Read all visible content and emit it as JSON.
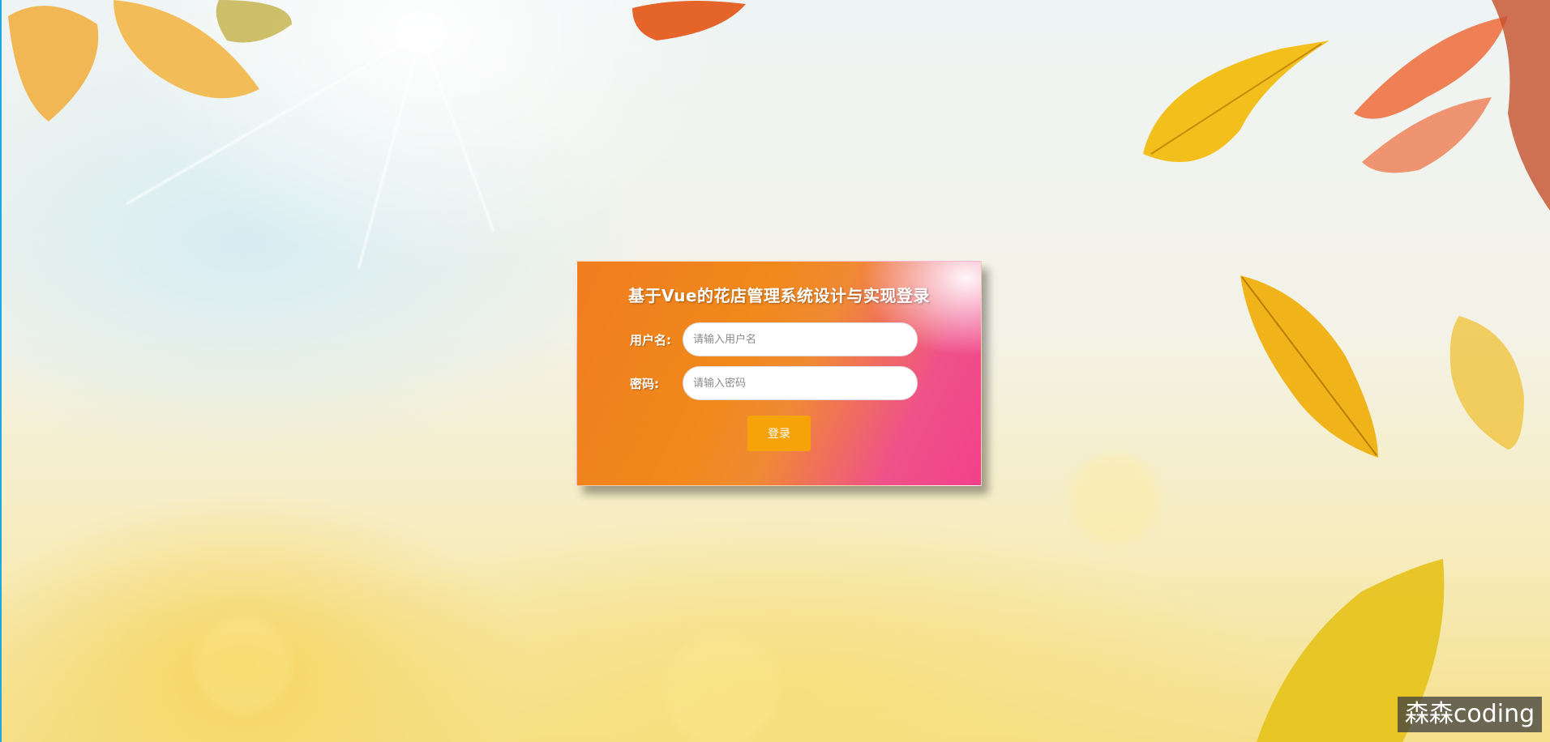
{
  "login": {
    "title": "基于Vue的花店管理系统设计与实现登录",
    "username_label": "用户名:",
    "username_placeholder": "请输入用户名",
    "username_value": "",
    "password_label": "密码:",
    "password_placeholder": "请输入密码",
    "password_value": "",
    "submit_label": "登录"
  },
  "watermark": {
    "text": "森森coding"
  },
  "colors": {
    "card_start": "#f07d1e",
    "card_end": "#f2418a",
    "button": "#f6a30a"
  }
}
